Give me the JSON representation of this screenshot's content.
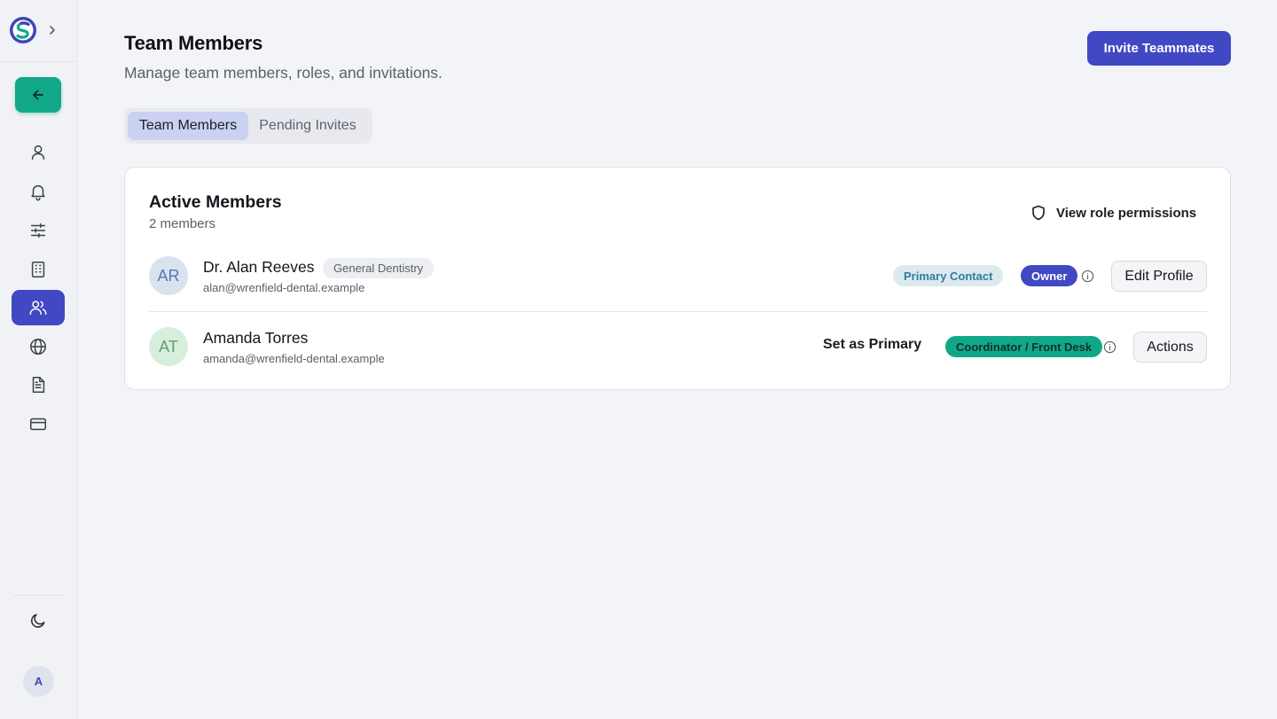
{
  "colors": {
    "accent": "#4148c4",
    "teal": "#11a88a",
    "tab_active_bg": "#cbd1f1"
  },
  "sidebar": {
    "logo_icon": "brand-logo-icon",
    "expand_icon": "chevron-right-icon",
    "back_icon": "arrow-left-icon",
    "items": [
      {
        "icon": "user-icon",
        "active": false
      },
      {
        "icon": "bell-icon",
        "active": false
      },
      {
        "icon": "sliders-icon",
        "active": false
      },
      {
        "icon": "building-icon",
        "active": false
      },
      {
        "icon": "users-icon",
        "active": true
      },
      {
        "icon": "globe-icon",
        "active": false
      },
      {
        "icon": "document-icon",
        "active": false
      },
      {
        "icon": "credit-card-icon",
        "active": false
      }
    ],
    "theme_icon": "moon-icon",
    "user_initial": "A"
  },
  "header": {
    "title": "Team Members",
    "subtitle": "Manage team members, roles, and invitations.",
    "invite_label": "Invite Teammates"
  },
  "tabs": [
    {
      "label": "Team Members",
      "active": true
    },
    {
      "label": "Pending Invites",
      "active": false
    }
  ],
  "card": {
    "title": "Active Members",
    "count": "2 members",
    "permissions_label": "View role permissions",
    "members": [
      {
        "initials": "AR",
        "name": "Dr. Alan Reeves",
        "email": "alan@wrenfield-dental.example",
        "specialty": "General Dentistry",
        "primary_badge": "Primary Contact",
        "role": "Owner",
        "action": "Edit Profile"
      },
      {
        "initials": "AT",
        "name": "Amanda Torres",
        "email": "amanda@wrenfield-dental.example",
        "set_primary": "Set as Primary",
        "role": "Coordinator / Front Desk",
        "action": "Actions"
      }
    ]
  }
}
